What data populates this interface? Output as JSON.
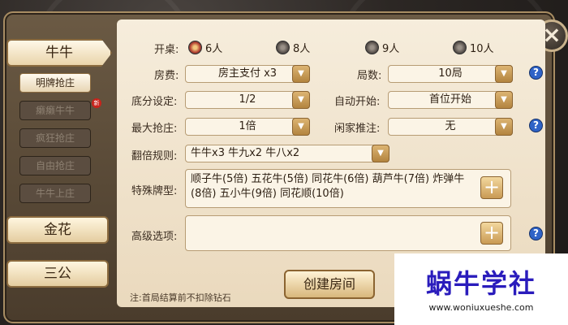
{
  "close_icon": "×",
  "sidebar": {
    "main_tabs": [
      {
        "label": "牛牛",
        "active": true
      },
      {
        "label": "金花"
      },
      {
        "label": "三公"
      }
    ],
    "sub_items": [
      {
        "label": "明牌抢庄",
        "active": true
      },
      {
        "label": "癞癞牛牛",
        "badge": "新"
      },
      {
        "label": "疯狂抢庄"
      },
      {
        "label": "自由抢庄"
      },
      {
        "label": "牛牛上庄"
      }
    ]
  },
  "form": {
    "table_size": {
      "label": "开桌:",
      "options": [
        {
          "label": "6人",
          "checked": true
        },
        {
          "label": "8人"
        },
        {
          "label": "9人"
        },
        {
          "label": "10人"
        }
      ]
    },
    "room_fee": {
      "label": "房费:",
      "value": "房主支付 x3"
    },
    "rounds": {
      "label": "局数:",
      "value": "10局"
    },
    "base_score": {
      "label": "底分设定:",
      "value": "1/2"
    },
    "auto_start": {
      "label": "自动开始:",
      "value": "首位开始"
    },
    "max_bid": {
      "label": "最大抢庄:",
      "value": "1倍"
    },
    "idle_push": {
      "label": "闲家推注:",
      "value": "无"
    },
    "multiplier_rule": {
      "label": "翻倍规则:",
      "value": "牛牛x3  牛九x2  牛八x2"
    },
    "special_cards": {
      "label": "特殊牌型:",
      "value": "顺子牛(5倍) 五花牛(5倍) 同花牛(6倍) 葫芦牛(7倍) 炸弹牛(8倍) 五小牛(9倍) 同花顺(10倍)"
    },
    "advanced": {
      "label": "高级选项:",
      "value": ""
    }
  },
  "create_button": "创建房间",
  "footnote": "注:首局结算前不扣除钻石",
  "watermark": {
    "name": "蜗牛学社",
    "url": "www.woniuxueshe.com"
  }
}
